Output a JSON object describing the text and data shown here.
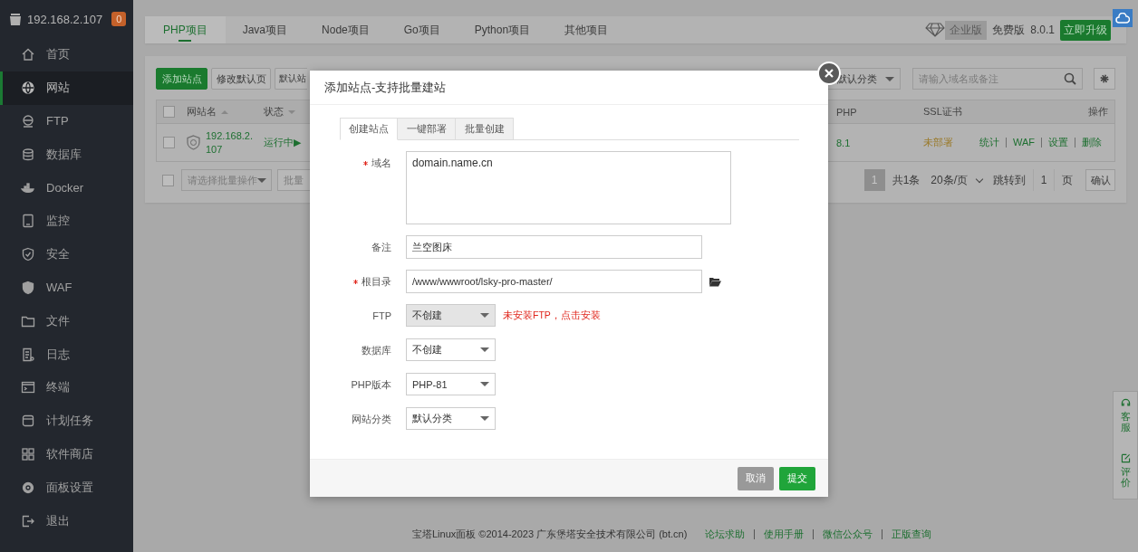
{
  "sidebar": {
    "host": "192.168.2.107",
    "badge": "0",
    "items": [
      {
        "label": "首页",
        "selected": false
      },
      {
        "label": "网站",
        "selected": true
      },
      {
        "label": "FTP",
        "selected": false
      },
      {
        "label": "数据库",
        "selected": false
      },
      {
        "label": "Docker",
        "selected": false
      },
      {
        "label": "监控",
        "selected": false
      },
      {
        "label": "安全",
        "selected": false
      },
      {
        "label": "WAF",
        "selected": false
      },
      {
        "label": "文件",
        "selected": false
      },
      {
        "label": "日志",
        "selected": false
      },
      {
        "label": "终端",
        "selected": false
      },
      {
        "label": "计划任务",
        "selected": false
      },
      {
        "label": "软件商店",
        "selected": false
      },
      {
        "label": "面板设置",
        "selected": false
      },
      {
        "label": "退出",
        "selected": false
      }
    ]
  },
  "project_tabs": [
    {
      "label": "PHP项目",
      "selected": true
    },
    {
      "label": "Java项目",
      "selected": false
    },
    {
      "label": "Node项目",
      "selected": false
    },
    {
      "label": "Go项目",
      "selected": false
    },
    {
      "label": "Python项目",
      "selected": false
    },
    {
      "label": "其他项目",
      "selected": false
    }
  ],
  "edition": {
    "enterprise": "企业版",
    "free": "免费版",
    "version": "8.0.1",
    "upgrade": "立即升级"
  },
  "toolbar": {
    "buttons": [
      {
        "label": "添加站点",
        "kind": "primary"
      },
      {
        "label": "修改默认页",
        "kind": "plain"
      },
      {
        "label": "默认站",
        "kind": "cut"
      }
    ],
    "category": "默认分类",
    "search_placeholder": "请输入域名或备注"
  },
  "table": {
    "select_all_checked": false,
    "columns": [
      "网站名",
      "状态",
      "PHP",
      "SSL证书",
      "操作"
    ],
    "rows": [
      {
        "checked": false,
        "name": "192.168.2.107",
        "status": "运行中▶",
        "php": "8.1",
        "ssl": "未部署",
        "actions": [
          "统计",
          "WAF",
          "设置",
          "删除"
        ]
      }
    ]
  },
  "batch": {
    "checked": false,
    "select": "请选择批量操作",
    "button": "批量"
  },
  "pagination": {
    "current": "1",
    "total": "共1条",
    "per_page": "20条/页",
    "jump": "跳转到",
    "page_input": "1",
    "page_unit": "页",
    "confirm": "确认"
  },
  "dialog": {
    "title": "添加站点-支持批量建站",
    "tabs": [
      {
        "label": "创建站点",
        "selected": true
      },
      {
        "label": "一键部署",
        "selected": false
      },
      {
        "label": "批量创建",
        "selected": false
      }
    ],
    "fields": [
      {
        "kind": "textarea",
        "label": "域名",
        "required": true,
        "value": "domain.name.cn"
      },
      {
        "kind": "input",
        "label": "备注",
        "required": false,
        "value": "兰空图床"
      },
      {
        "kind": "path",
        "label": "根目录",
        "required": true,
        "value": "/www/wwwroot/lsky-pro-master/"
      },
      {
        "kind": "select",
        "label": "FTP",
        "required": false,
        "value": "不创建",
        "disabled": true,
        "note": "未安装FTP，点击安装"
      },
      {
        "kind": "select",
        "label": "数据库",
        "required": false,
        "value": "不创建",
        "disabled": false
      },
      {
        "kind": "select",
        "label": "PHP版本",
        "required": false,
        "value": "PHP-81",
        "disabled": false
      },
      {
        "kind": "select",
        "label": "网站分类",
        "required": false,
        "value": "默认分类",
        "disabled": false
      }
    ],
    "cancel": "取消",
    "submit": "提交"
  },
  "footer": {
    "copyright": "宝塔Linux面板 ©2014-2023 广东堡塔安全技术有限公司 (bt.cn)",
    "links": [
      "论坛求助",
      "使用手册",
      "微信公众号",
      "正版查询"
    ]
  },
  "float_tabs": [
    "客服",
    "评价"
  ]
}
